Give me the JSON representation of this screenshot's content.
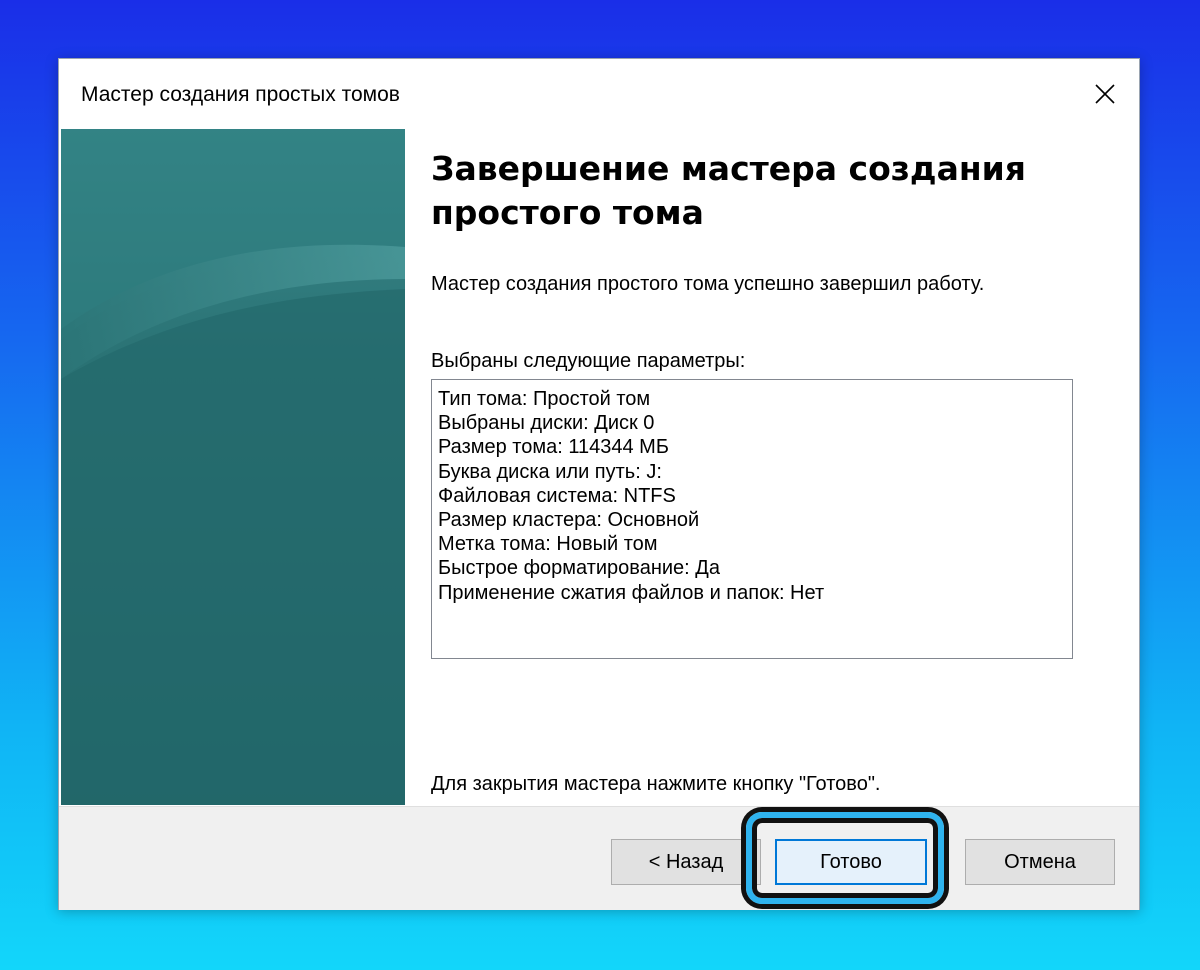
{
  "window": {
    "title": "Мастер создания простых томов",
    "close_icon": "close-icon"
  },
  "content": {
    "heading_line1": "Завершение мастера создания",
    "heading_line2": "простого тома",
    "description": "Мастер создания простого тома успешно завершил работу.",
    "params_label": "Выбраны следующие параметры:",
    "params": [
      "Тип тома: Простой том",
      "Выбраны диски: Диск 0",
      "Размер тома: 114344 МБ",
      "Буква диска или путь: J:",
      "Файловая система: NTFS",
      "Размер кластера: Основной",
      "Метка тома: Новый том",
      "Быстрое форматирование: Да",
      "Применение сжатия файлов и папок: Нет"
    ],
    "finish_hint": "Для закрытия мастера нажмите кнопку \"Готово\"."
  },
  "buttons": {
    "back": "< Назад",
    "finish": "Готово",
    "cancel": "Отмена"
  },
  "colors": {
    "side_panel": "#256c6f",
    "highlight": "#2fb3ee",
    "focus_border": "#0078d7"
  }
}
